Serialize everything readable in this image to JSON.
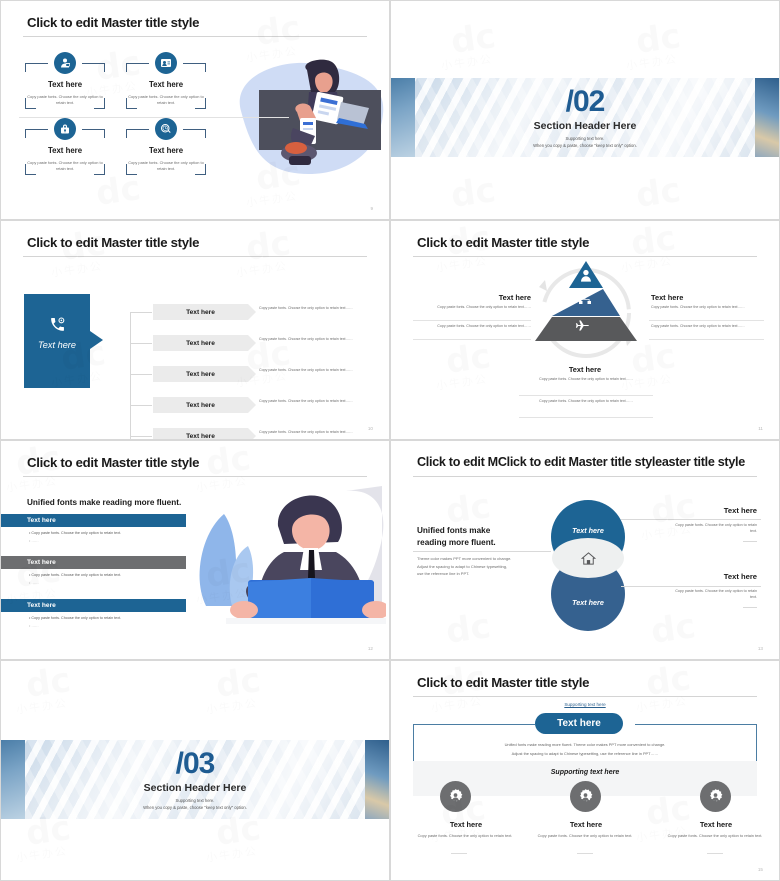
{
  "common": {
    "title": "Click to edit Master title style",
    "text_here": "Text here",
    "copy_paste": "Copy paste fonts. Choose the only option to retain text.",
    "copy_paste_ellipsis": "Copy paste fonts. Choose the only option to retain text…..",
    "accent_blue": "#1d6494",
    "accent_blue_mid": "#2f5c8a",
    "accent_gray": "#6d6e70",
    "band_gray": "#ebebeb"
  },
  "slides": [
    {
      "id": "four-feature-boxes",
      "title": "Click to edit Master title style",
      "page": "9",
      "boxes": [
        {
          "icon": "user-lock-icon",
          "heading": "Text here",
          "body": "Copy paste fonts. Choose the only option to retain text."
        },
        {
          "icon": "user-card-icon",
          "heading": "Text here",
          "body": "Copy paste fonts. Choose the only option to retain text."
        },
        {
          "icon": "lock-shield-icon",
          "heading": "Text here",
          "body": "Copy paste fonts. Choose the only option to retain text."
        },
        {
          "icon": "search-clock-icon",
          "heading": "Text here",
          "body": "Copy paste fonts. Choose the only option to retain text."
        }
      ]
    },
    {
      "id": "section-header-02",
      "number": "/02",
      "title": "Section Header Here",
      "sub1": "Supporting text here.",
      "sub2": "When you copy & paste, choose \"keep text only\" option."
    },
    {
      "id": "process-five-steps",
      "title": "Click to edit Master title style",
      "page": "10",
      "left_block": {
        "icon": "phone-ring-icon",
        "label": "Text here"
      },
      "steps": [
        {
          "label": "Text here",
          "body": "Copy paste fonts. Choose the only option to retain text……"
        },
        {
          "label": "Text here",
          "body": "Copy paste fonts. Choose the only option to retain text……"
        },
        {
          "label": "Text here",
          "body": "Copy paste fonts. Choose the only option to retain text……"
        },
        {
          "label": "Text here",
          "body": "Copy paste fonts. Choose the only option to retain text……"
        },
        {
          "label": "Text here",
          "body": "Copy paste fonts. Choose the only option to retain text……"
        }
      ]
    },
    {
      "id": "pyramid-three-tier",
      "title": "Click to edit Master title style",
      "page": "11",
      "tiers": [
        {
          "icon": "businessman-icon",
          "color": "#1d6494"
        },
        {
          "icon": "org-chart-icon",
          "color": "#35618f"
        },
        {
          "icon": "airplane-icon",
          "color": "#58595b"
        }
      ],
      "left": {
        "heading": "Text here",
        "body1": "Copy paste fonts. Choose the only option to retain text……",
        "body2": "Copy paste fonts. Choose the only option to retain text……"
      },
      "right": {
        "heading": "Text here",
        "body1": "Copy paste fonts. Choose the only option to retain text……",
        "body2": "Copy paste fonts. Choose the only option to retain text……"
      },
      "bottom": {
        "heading": "Text here",
        "body1": "Copy paste fonts. Choose the only option to retain text……",
        "body2": "Copy paste fonts. Choose the only option to retain text……"
      }
    },
    {
      "id": "reading-three-bars",
      "title": "Click to edit Master title style",
      "page": "12",
      "lead": "Unified fonts make reading more fluent.",
      "bars": [
        {
          "label": "Text here",
          "color": "#1d6494",
          "bullet1": "Copy paste fonts. Choose the only option to retain text.",
          "bullet2": "……"
        },
        {
          "label": "Text here",
          "color": "#6d6e70",
          "bullet1": "Copy paste fonts. Choose the only option to retain text.",
          "bullet2": "……"
        },
        {
          "label": "Text here",
          "color": "#1d6494",
          "bullet1": "Copy paste fonts. Choose the only option to retain text.",
          "bullet2": "……"
        }
      ]
    },
    {
      "id": "two-circles-venn",
      "title": "Click to edit MClick to edit Master title styleaster title style",
      "page": "13",
      "center_icon": "house-icon",
      "circle_top": "Text here",
      "circle_bottom": "Text here",
      "lead_heading": "Unified fonts make\nreading more fluent.",
      "lead_body": "Theme color makes PPT more convenient to change.\nAdjust the spacing to adapt to Chinese typesetting,\nuse the reference line in PPT.",
      "right_top": {
        "heading": "Text here",
        "body": "Copy paste fonts. Choose the only option to retain text."
      },
      "right_bottom": {
        "heading": "Text here",
        "body": "Copy paste fonts. Choose the only option to retain text."
      }
    },
    {
      "id": "section-header-03",
      "number": "/03",
      "title": "Section Header Here",
      "sub1": "Supporting text here.",
      "sub2": "When you copy & paste, choose \"keep text only\" option."
    },
    {
      "id": "three-gear-columns",
      "title": "Click to edit Master title style",
      "page": "15",
      "supporting_top": "Supporting text here",
      "pill_label": "Text here",
      "body_line1": "Unified fonts make reading more fluent. Theme color makes PPT more convenient to change.",
      "body_line2": "Adjust the spacing to adapt to Chinese typesetting, use the reference line in PPT……",
      "band_label": "Supporting text here",
      "columns": [
        {
          "icon": "gear-user-icon",
          "heading": "Text here",
          "body": "Copy paste fonts. Choose the only option to retain text."
        },
        {
          "icon": "gear-user-icon",
          "heading": "Text here",
          "body": "Copy paste fonts. Choose the only option to retain text."
        },
        {
          "icon": "gear-user-icon",
          "heading": "Text here",
          "body": "Copy paste fonts. Choose the only option to retain text."
        }
      ]
    }
  ],
  "watermark": {
    "mark": "dc",
    "sub": "小牛办公"
  }
}
